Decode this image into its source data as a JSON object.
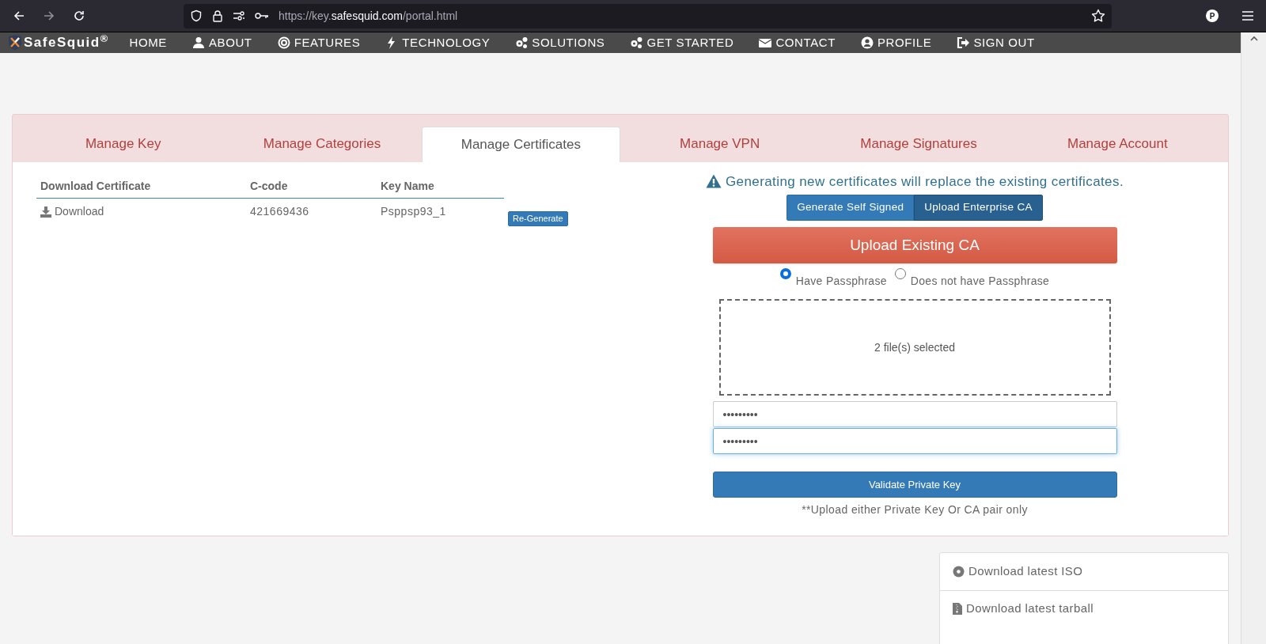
{
  "browser": {
    "url_prefix": "https://key.",
    "url_domain": "safesquid.com",
    "url_path": "/portal.html",
    "profile": "P"
  },
  "navbar": {
    "brand": "SafeSquid$^{®}$",
    "items": [
      {
        "label": "HOME"
      },
      {
        "label": "ABOUT"
      },
      {
        "label": "FEATURES"
      },
      {
        "label": "TECHNOLOGY"
      },
      {
        "label": "SOLUTIONS"
      },
      {
        "label": "GET STARTED"
      },
      {
        "label": "CONTACT"
      },
      {
        "label": "PROFILE"
      },
      {
        "label": "SIGN OUT"
      }
    ]
  },
  "tabs": [
    {
      "label": "Manage Key",
      "selected": false
    },
    {
      "label": "Manage Categories",
      "selected": false
    },
    {
      "label": "Manage Certificates",
      "selected": true
    },
    {
      "label": "Manage VPN",
      "selected": false
    },
    {
      "label": "Manage Signatures",
      "selected": false
    },
    {
      "label": "Manage Account",
      "selected": false
    }
  ],
  "table": {
    "columns": [
      "Download Certificate",
      "C-code",
      "Key Name"
    ],
    "rows": [
      {
        "download": "Download",
        "c_code": "421669436",
        "key_name": "Psppsp93_1",
        "action": "Re-Generate"
      }
    ]
  },
  "warning": "Generating new certificates will replace the existing certificates.",
  "mode_buttons": [
    {
      "label": "Generate Self Signed",
      "selected": false
    },
    {
      "label": "Upload Enterprise CA",
      "selected": true
    }
  ],
  "upload_title": "Upload Existing CA",
  "passphrase_options": [
    {
      "label": "Have Passphrase",
      "selected": true
    },
    {
      "label": "Does not have Passphrase",
      "selected": false
    }
  ],
  "dropzone": "2 file(s) selected",
  "password_fields": [
    {
      "value": "•••••••••",
      "focused": false
    },
    {
      "value": "•••••••••",
      "focused": true
    }
  ],
  "validate_button": "Validate Private Key",
  "note": "**Upload either Private Key Or CA pair only",
  "downloads": [
    "Download latest ISO",
    "Download latest tarball"
  ]
}
